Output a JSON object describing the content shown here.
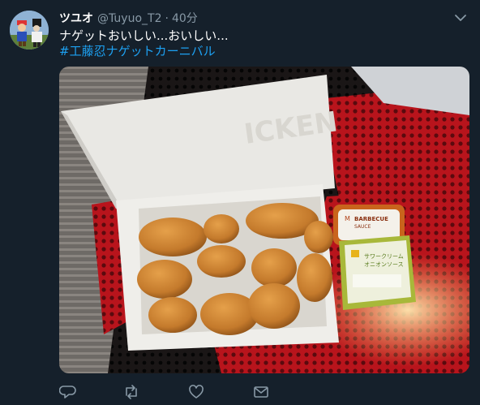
{
  "tweet": {
    "display_name": "ツユオ",
    "handle": "@Tuyuo_T2",
    "separator": "·",
    "time": "40分",
    "text": "ナゲットおいしい...おいしい...",
    "hashtag": "#工藤忍ナゲットカーニバル"
  },
  "media": {
    "box_labels": {
      "sauce_top_line1": "BARBECUE",
      "sauce_top_line2": "SAUCE",
      "sauce_bottom_line1": "サワークリーム",
      "sauce_bottom_line2": "オニオンソース"
    }
  },
  "actions": {
    "reply_icon": "reply-icon",
    "retweet_icon": "retweet-icon",
    "like_icon": "heart-icon",
    "dm_icon": "envelope-icon"
  },
  "colors": {
    "background": "#15202b",
    "text_primary": "#ffffff",
    "text_secondary": "#8899a6",
    "link": "#1da1f2"
  }
}
